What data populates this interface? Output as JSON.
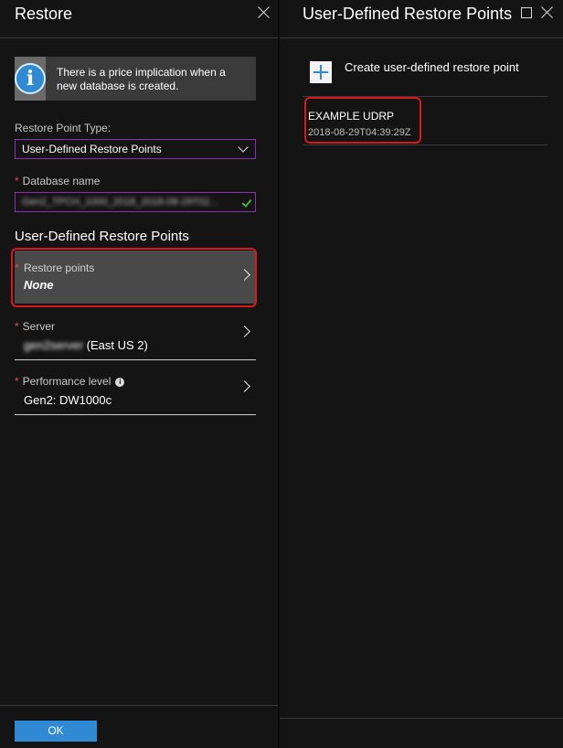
{
  "restore_blade": {
    "title": "Restore",
    "info_message": "There is a price implication when a new database is created.",
    "restore_point_type_label": "Restore Point Type:",
    "restore_point_type_value": "User-Defined Restore Points",
    "required_marker": "*",
    "database_name_label": "Database name",
    "database_name_value": "Gen2_TPCH_1000_2018_2018-08-29T02...",
    "section_title": "User-Defined Restore Points",
    "restore_points_label": "Restore points",
    "restore_points_value": "None",
    "server_label": "Server",
    "server_name": "gen2server",
    "server_region": "(East US 2)",
    "performance_label": "Performance level",
    "performance_info_icon": "i",
    "performance_value": "Gen2: DW1000c",
    "ok_label": "OK"
  },
  "udrp_blade": {
    "title": "User-Defined Restore Points",
    "create_label": "Create user-defined restore point",
    "items": [
      {
        "name": "EXAMPLE UDRP",
        "timestamp": "2018-08-29T04:39:29Z"
      }
    ]
  },
  "colors": {
    "accent_blue": "#2f8ad3",
    "highlight_red": "#d7191c",
    "focus_purple": "#8a2fb0",
    "valid_green": "#4cae4c"
  },
  "icons": [
    "info-icon",
    "close-icon",
    "maximize-icon",
    "chevron-down-icon",
    "chevron-right-icon",
    "checkmark-icon",
    "plus-icon"
  ]
}
